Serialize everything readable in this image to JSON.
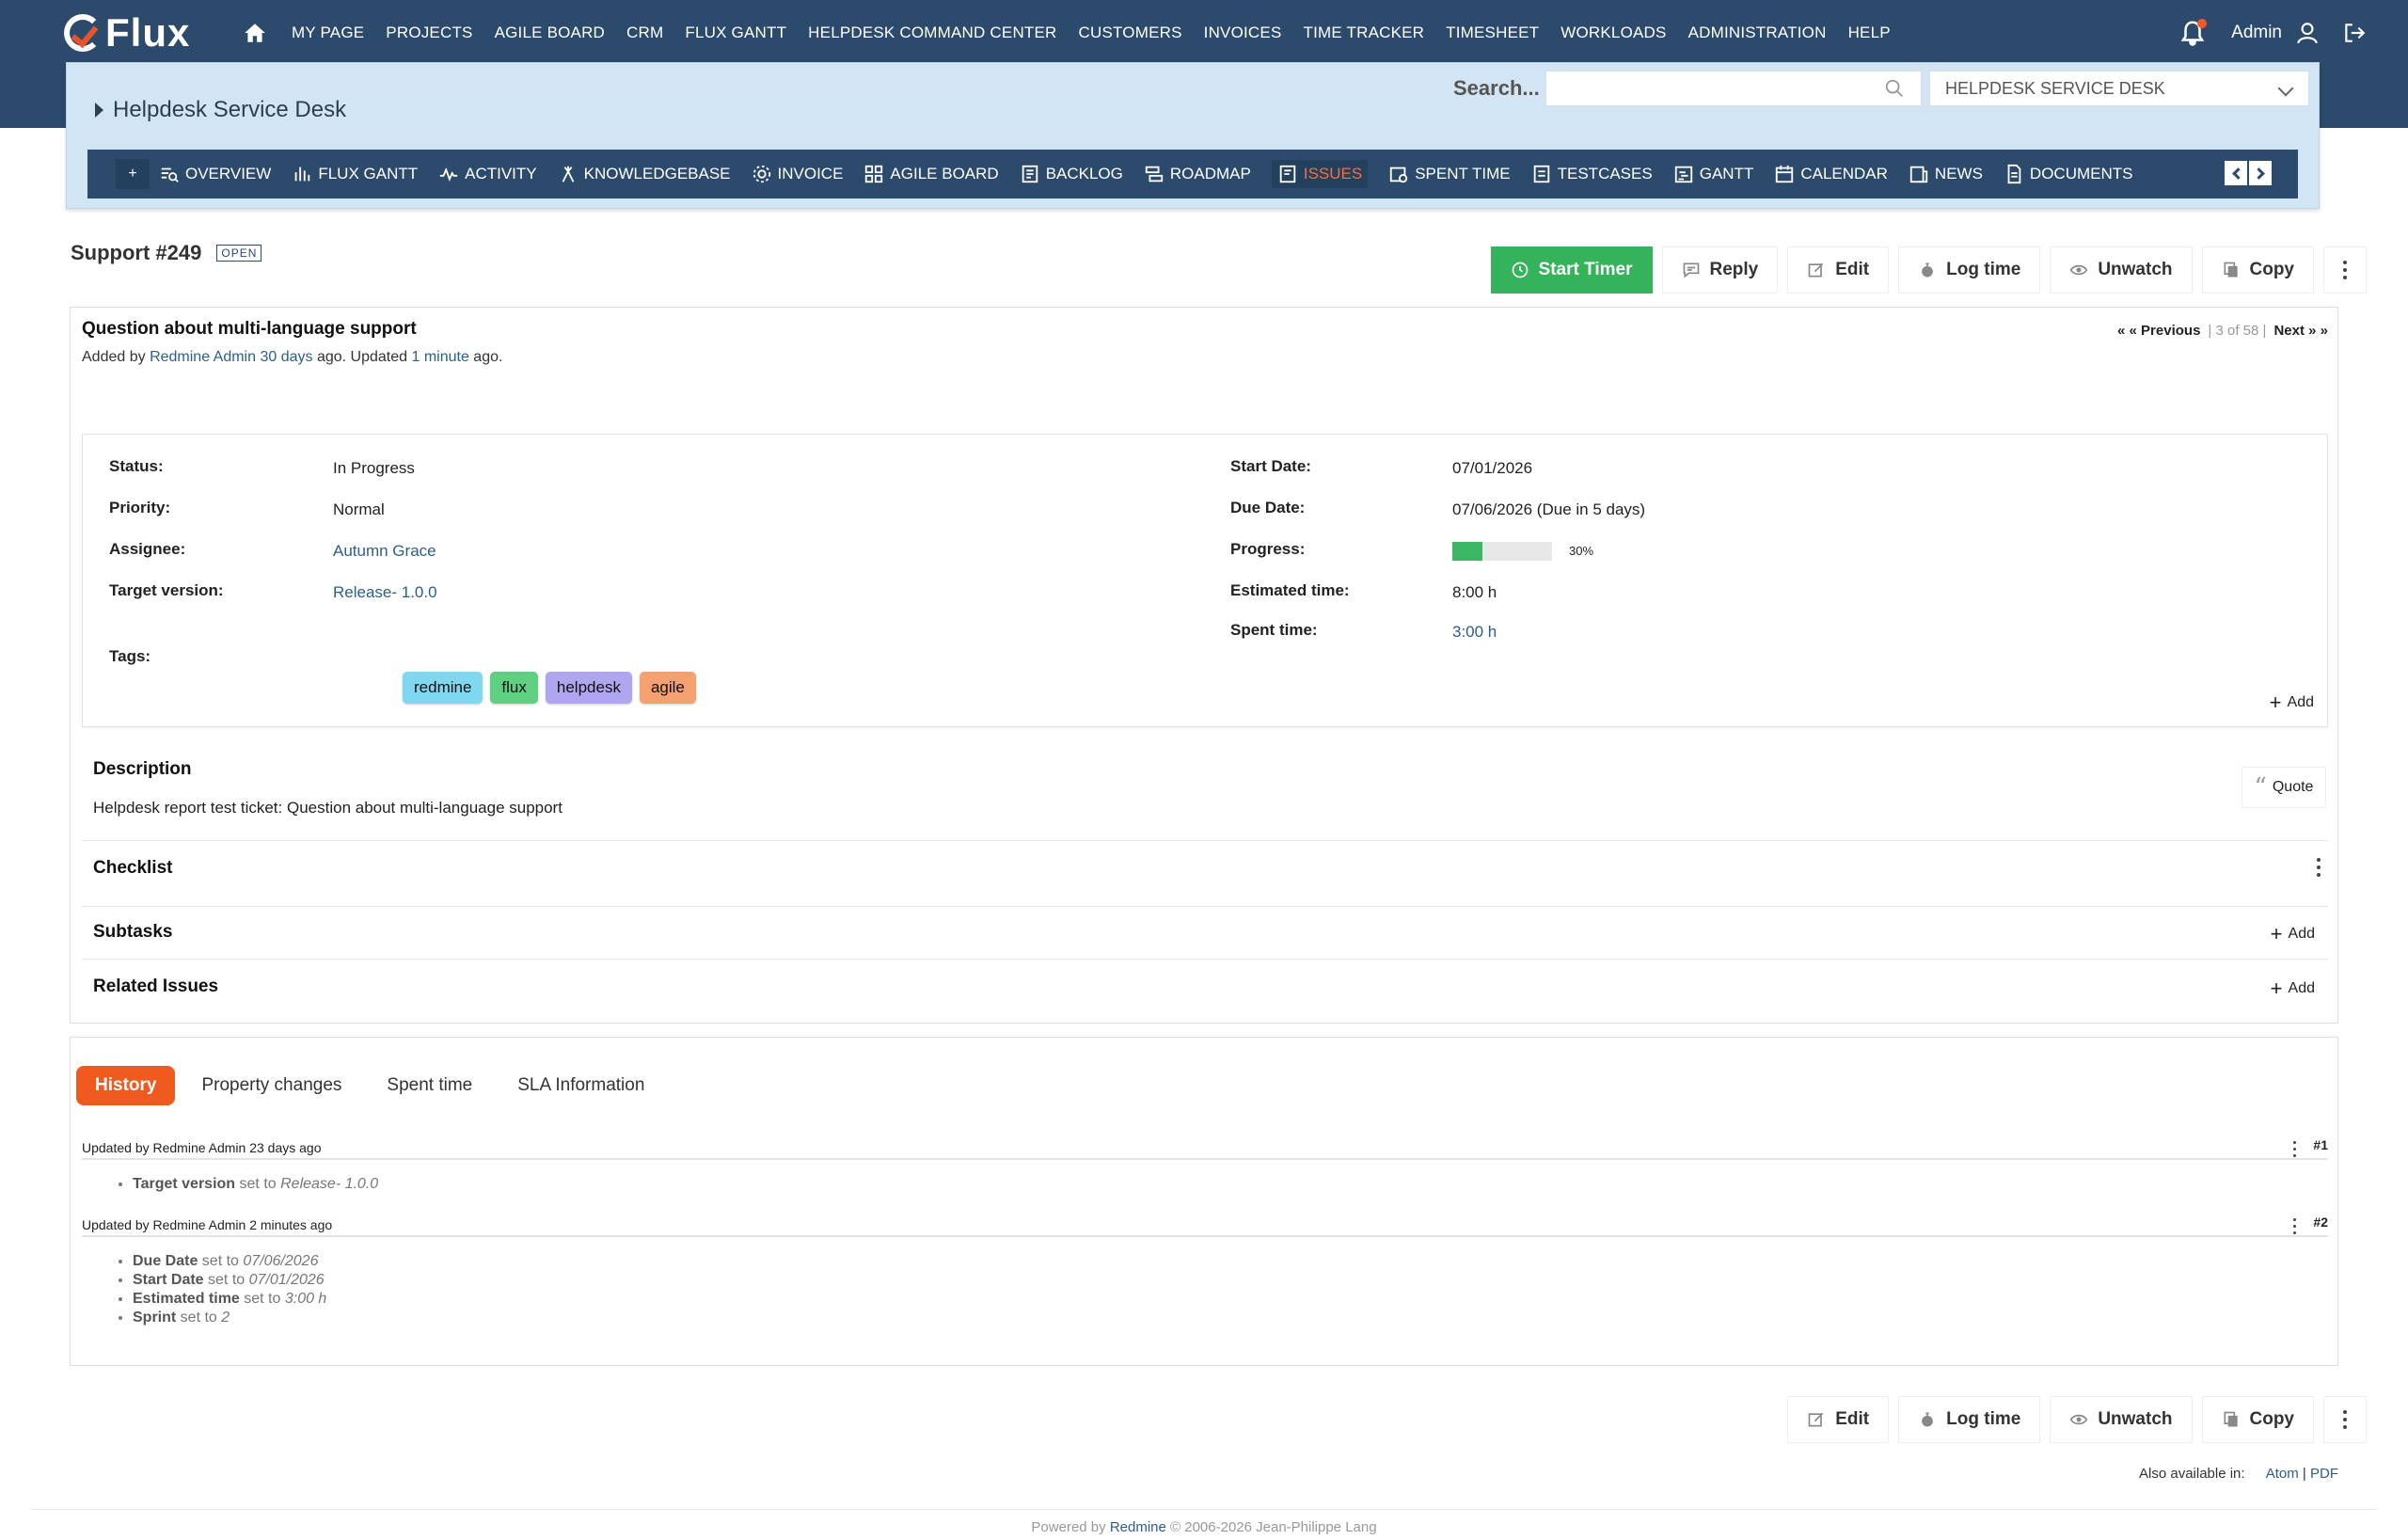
{
  "app": {
    "logo_text": "Flux"
  },
  "topnav": {
    "items": [
      "MY PAGE",
      "PROJECTS",
      "AGILE BOARD",
      "CRM",
      "FLUX GANTT",
      "HELPDESK COMMAND CENTER",
      "CUSTOMERS",
      "INVOICES",
      "TIME TRACKER",
      "TIMESHEET",
      "WORKLOADS",
      "ADMINISTRATION",
      "HELP"
    ],
    "user": "Admin"
  },
  "project": {
    "title": "Helpdesk Service Desk",
    "search_label": "Search...",
    "search_value": "",
    "selected": "HELPDESK SERVICE DESK"
  },
  "tabs": {
    "plus": "+",
    "items": [
      "OVERVIEW",
      "FLUX GANTT",
      "ACTIVITY",
      "KNOWLEDGEBASE",
      "INVOICE",
      "AGILE BOARD",
      "BACKLOG",
      "ROADMAP",
      "ISSUES",
      "SPENT TIME",
      "TESTCASES",
      "GANTT",
      "CALENDAR",
      "NEWS",
      "DOCUMENTS"
    ]
  },
  "issue": {
    "id": "Support #249",
    "status_badge": "OPEN",
    "subject": "Question about multi-language support",
    "added_prefix": "Added by ",
    "author": "Redmine Admin",
    "added_ago": "30 days",
    "added_mid": " ago. Updated ",
    "updated_ago": "1 minute",
    "added_suffix": " ago.",
    "pager": {
      "prev": "« « Previous",
      "count": "3 of 58",
      "next": "Next » »"
    },
    "labels": {
      "status": "Status:",
      "priority": "Priority:",
      "assignee": "Assignee:",
      "target_version": "Target version:",
      "tags": "Tags:",
      "start_date": "Start Date:",
      "due_date": "Due Date:",
      "progress": "Progress:",
      "estimated": "Estimated time:",
      "spent": "Spent time:"
    },
    "values": {
      "status": "In Progress",
      "priority": "Normal",
      "assignee": "Autumn Grace",
      "target_version": "Release- 1.0.0",
      "start_date": "07/01/2026",
      "due_date": "07/06/2026 (Due in 5 days)",
      "progress_text": "30%",
      "progress": 0.3,
      "estimated": "8:00 h",
      "spent": "3:00 h"
    },
    "tags": [
      "redmine",
      "flux",
      "helpdesk",
      "agile"
    ],
    "add": "Add",
    "description_title": "Description",
    "description_text": "Helpdesk report test ticket: Question about multi-language support",
    "quote": "Quote",
    "checklist": "Checklist",
    "subtasks": "Subtasks",
    "related": "Related Issues"
  },
  "actions": {
    "start_timer": "Start Timer",
    "reply": "Reply",
    "edit": "Edit",
    "log_time": "Log time",
    "unwatch": "Unwatch",
    "copy": "Copy"
  },
  "history": {
    "tabs": [
      "History",
      "Property changes",
      "Spent time",
      "SLA Information"
    ],
    "journals": [
      {
        "header": "Updated by Redmine Admin 23 days ago",
        "num": "#1",
        "changes": [
          {
            "field": "Target version",
            "text": " set to ",
            "value": "Release- 1.0.0"
          }
        ]
      },
      {
        "header": "Updated by Redmine Admin 2 minutes ago",
        "num": "#2",
        "changes": [
          {
            "field": "Due Date",
            "text": " set to ",
            "value": "07/06/2026"
          },
          {
            "field": "Start Date",
            "text": " set to ",
            "value": "07/01/2026"
          },
          {
            "field": "Estimated time",
            "text": " set to ",
            "value": "3:00 h"
          },
          {
            "field": "Sprint",
            "text": " set to ",
            "value": "2"
          }
        ]
      }
    ]
  },
  "footer": {
    "also_available": "Also available in:",
    "atom": "Atom",
    "sep": " | ",
    "pdf": "PDF",
    "powered_prefix": "Powered by ",
    "powered_link": "Redmine",
    "powered_suffix": " © 2006-2026 Jean-Philippe Lang"
  },
  "colors": {
    "navbar": "#2c4a6b",
    "accent": "#f05a1e",
    "timer": "#35b35a",
    "panel": "#d2e5f5"
  }
}
